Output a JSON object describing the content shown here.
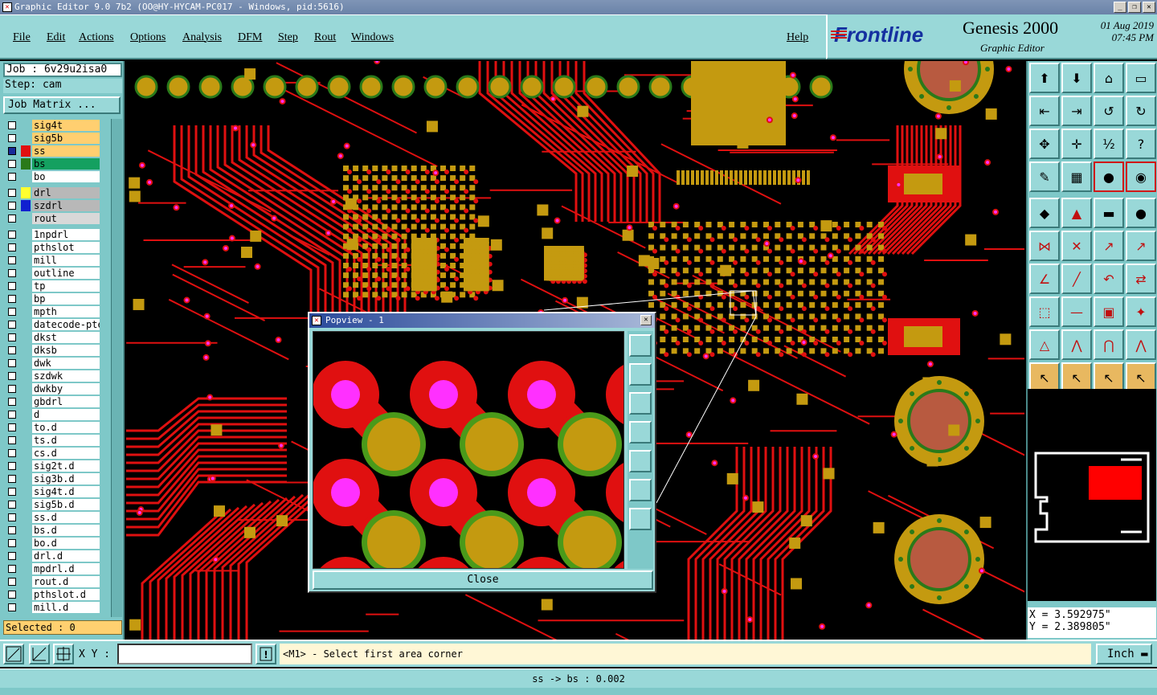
{
  "window": {
    "title": "Graphic Editor 9.0 7b2 (OO@HY-HYCAM-PC017 - Windows, pid:5616)"
  },
  "menu": {
    "items": [
      "File",
      "Edit",
      "Actions",
      "Options",
      "Analysis",
      "DFM",
      "Step",
      "Rout",
      "Windows"
    ],
    "help": "Help"
  },
  "brand": {
    "logo": "Frontline",
    "product": "Genesis 2000",
    "subtitle": "Graphic Editor",
    "date": "01 Aug 2019",
    "time": "07:45 PM"
  },
  "job": {
    "job_label": "Job : 6v29u2isa0",
    "step_label": "Step: cam",
    "matrix_button": "Job Matrix ..."
  },
  "layers": [
    {
      "name": "sig4t",
      "color": "#ffcf70",
      "swatch": "#7ec8c8"
    },
    {
      "name": "sig5b",
      "color": "#ffcf70",
      "swatch": "#7ec8c8"
    },
    {
      "name": "ss",
      "color": "#ffcf70",
      "swatch": "#e01010",
      "active": true
    },
    {
      "name": "bs",
      "color": "#14a060",
      "swatch": "#2a7a1a"
    },
    {
      "name": "bo",
      "color": "#ffffff",
      "swatch": "#7ec8c8"
    },
    {
      "name": "drl",
      "color": "#b8b8b8",
      "swatch": "#ffff30"
    },
    {
      "name": "szdrl",
      "color": "#b8b8b8",
      "swatch": "#1020d0"
    },
    {
      "name": "rout",
      "color": "#d8d8d8",
      "swatch": "#7ec8c8"
    },
    {
      "name": "1npdrl",
      "color": "#ffffff"
    },
    {
      "name": "pthslot",
      "color": "#ffffff"
    },
    {
      "name": "mill",
      "color": "#ffffff"
    },
    {
      "name": "outline",
      "color": "#ffffff"
    },
    {
      "name": "tp",
      "color": "#ffffff"
    },
    {
      "name": "bp",
      "color": "#ffffff"
    },
    {
      "name": "mpth",
      "color": "#ffffff"
    },
    {
      "name": "datecode-pte",
      "color": "#ffffff"
    },
    {
      "name": "dkst",
      "color": "#ffffff"
    },
    {
      "name": "dksb",
      "color": "#ffffff"
    },
    {
      "name": "dwk",
      "color": "#ffffff"
    },
    {
      "name": "szdwk",
      "color": "#ffffff"
    },
    {
      "name": "dwkby",
      "color": "#ffffff"
    },
    {
      "name": "gbdrl",
      "color": "#ffffff"
    },
    {
      "name": "d",
      "color": "#ffffff"
    },
    {
      "name": "to.d",
      "color": "#ffffff"
    },
    {
      "name": "ts.d",
      "color": "#ffffff"
    },
    {
      "name": "cs.d",
      "color": "#ffffff"
    },
    {
      "name": "sig2t.d",
      "color": "#ffffff"
    },
    {
      "name": "sig3b.d",
      "color": "#ffffff"
    },
    {
      "name": "sig4t.d",
      "color": "#ffffff"
    },
    {
      "name": "sig5b.d",
      "color": "#ffffff"
    },
    {
      "name": "ss.d",
      "color": "#ffffff"
    },
    {
      "name": "bs.d",
      "color": "#ffffff"
    },
    {
      "name": "bo.d",
      "color": "#ffffff"
    },
    {
      "name": "drl.d",
      "color": "#ffffff"
    },
    {
      "name": "mpdrl.d",
      "color": "#ffffff"
    },
    {
      "name": "rout.d",
      "color": "#ffffff"
    },
    {
      "name": "pthslot.d",
      "color": "#ffffff"
    },
    {
      "name": "mill.d",
      "color": "#ffffff"
    }
  ],
  "selected": "Selected : 0",
  "coords": {
    "x": "X = 3.592975\"",
    "y": "Y = 2.389805\""
  },
  "bottom": {
    "xy_label": "X Y :",
    "xy_value": "",
    "message": "<M1> - Select first area corner",
    "units": "Inch"
  },
  "status": "ss -> bs : 0.002",
  "popview": {
    "title": "Popview - 1",
    "close": "Close"
  },
  "colors": {
    "copper": "#c49a10",
    "trace": "#e01010",
    "via": "#ff30ff",
    "panel": "#99d8d8"
  }
}
